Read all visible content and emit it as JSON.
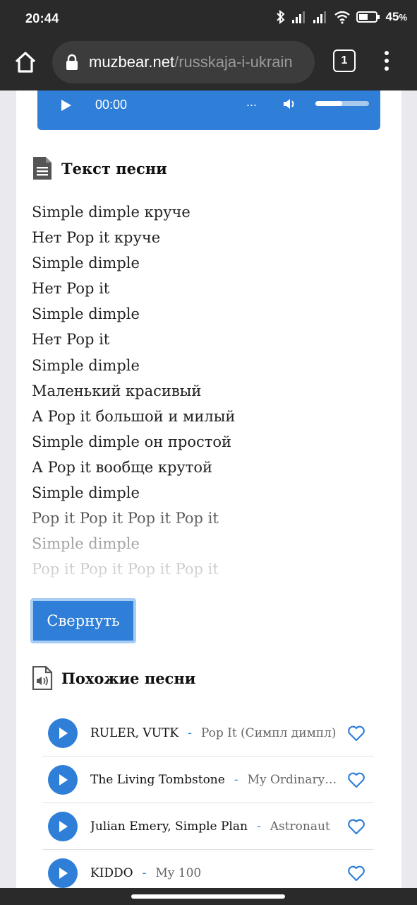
{
  "status_bar": {
    "time": "20:44",
    "battery_percent": "45",
    "battery_sign": "%",
    "icons": [
      "bluetooth-icon",
      "signal-icon",
      "signal-icon",
      "wifi-icon",
      "battery-icon"
    ]
  },
  "browser": {
    "url_host": "muzbear.net",
    "url_path": "/russkaja-i-ukrain",
    "tab_count": "1"
  },
  "player": {
    "time": "00:00",
    "dots": "...",
    "volume_fraction": 0.5
  },
  "lyrics_section": {
    "title": "Текст песни",
    "lines": [
      "Simple dimple круче",
      "Нет Pop it круче",
      "Simple dimple",
      "Нет Pop it",
      "Simple dimple",
      "Нет Pop it",
      "Simple dimple",
      "Маленький красивый",
      "А Pop it большой и милый",
      "Simple dimple он простой",
      "А Pop it вообще крутой",
      "Simple dimple",
      "Pop it Pop it Pop it Pop it",
      "Simple dimple",
      "Pop it Pop it Pop it Pop it"
    ],
    "collapse_label": "Свернуть"
  },
  "similar_section": {
    "title": "Похожие песни",
    "songs": [
      {
        "artist": "RULER, VUTK",
        "sep": "-",
        "title": "Pop It (Симпл димпл)"
      },
      {
        "artist": "The Living Tombstone",
        "sep": "-",
        "title": "My Ordinary Life"
      },
      {
        "artist": "Julian Emery, Simple Plan",
        "sep": "-",
        "title": "Astronaut"
      },
      {
        "artist": "KIDDO",
        "sep": "-",
        "title": "My 100"
      }
    ]
  },
  "colors": {
    "accent": "#2f7fd8",
    "bar_dark": "#2a2a2a"
  }
}
